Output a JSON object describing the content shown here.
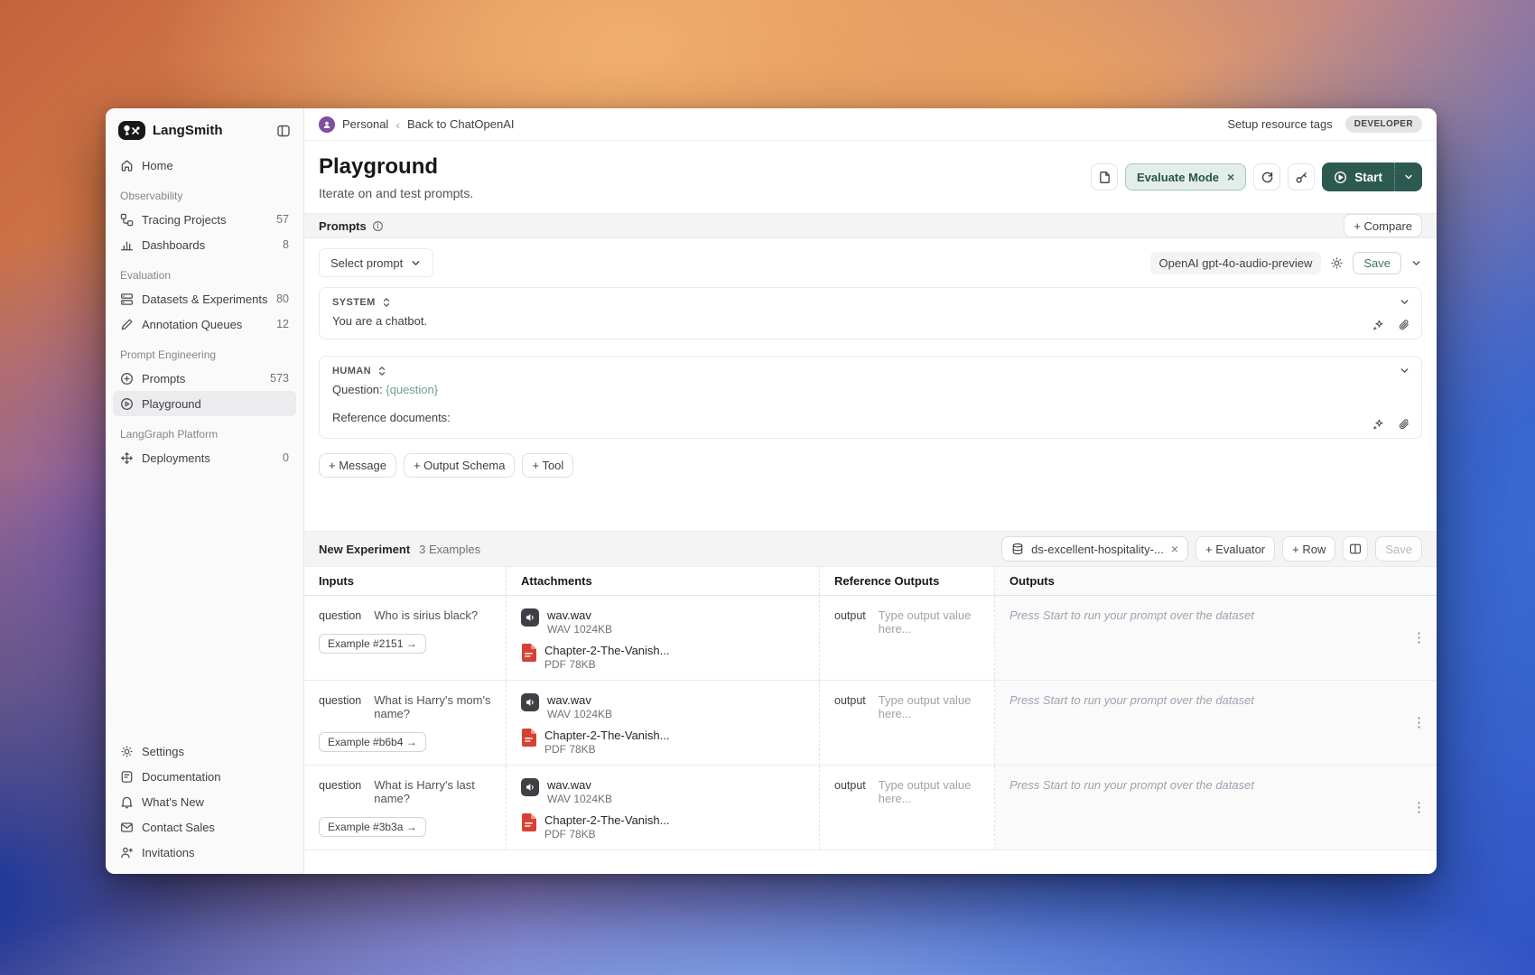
{
  "icons": {
    "crumb_sep": "‹",
    "close": "×",
    "overflow": "⋮"
  },
  "sidebar": {
    "brand": "LangSmith",
    "home": {
      "label": "Home"
    },
    "sections": [
      {
        "label": "Observability",
        "items": [
          {
            "label": "Tracing Projects",
            "count": "57"
          },
          {
            "label": "Dashboards",
            "count": "8"
          }
        ]
      },
      {
        "label": "Evaluation",
        "items": [
          {
            "label": "Datasets & Experiments",
            "count": "80"
          },
          {
            "label": "Annotation Queues",
            "count": "12"
          }
        ]
      },
      {
        "label": "Prompt Engineering",
        "items": [
          {
            "label": "Prompts",
            "count": "573"
          },
          {
            "label": "Playground",
            "count": ""
          }
        ]
      },
      {
        "label": "LangGraph Platform",
        "items": [
          {
            "label": "Deployments",
            "count": "0"
          }
        ]
      }
    ],
    "footer": [
      {
        "label": "Settings"
      },
      {
        "label": "Documentation"
      },
      {
        "label": "What's New"
      },
      {
        "label": "Contact Sales"
      },
      {
        "label": "Invitations"
      }
    ]
  },
  "topbar": {
    "workspace": "Personal",
    "back": "Back to ChatOpenAI",
    "setup": "Setup resource tags",
    "badge": "DEVELOPER"
  },
  "header": {
    "title": "Playground",
    "subtitle": "Iterate on and test prompts.",
    "evaluate_mode": "Evaluate Mode",
    "start": "Start"
  },
  "prompts": {
    "title": "Prompts",
    "compare": "+ Compare",
    "select_prompt": "Select prompt",
    "model": "OpenAI gpt-4o-audio-preview",
    "save": "Save",
    "system_role": "SYSTEM",
    "system_text": "You are a chatbot.",
    "human_role": "HUMAN",
    "human_q_prefix": "Question: ",
    "human_q_var": "{question}",
    "human_ref": "Reference documents:",
    "add_message": "+ Message",
    "add_output_schema": "+ Output Schema",
    "add_tool": "+ Tool"
  },
  "experiment": {
    "title": "New Experiment",
    "examples": "3 Examples",
    "dataset": "ds-excellent-hospitality-...",
    "add_evaluator": "+ Evaluator",
    "add_row": "+ Row",
    "save": "Save"
  },
  "table": {
    "headers": [
      "Inputs",
      "Attachments",
      "Reference Outputs",
      "Outputs"
    ],
    "output_placeholder": "Press Start to run your prompt over the dataset",
    "rows": [
      {
        "key": "question",
        "value": "Who is sirius black?",
        "example": "Example #2151 →",
        "ref_key": "output",
        "ref_placeholder": "Type output value here...",
        "attachments": [
          {
            "name": "wav.wav",
            "meta": "WAV  1024KB"
          },
          {
            "name": "Chapter-2-The-Vanish...",
            "meta": "PDF  78KB"
          }
        ]
      },
      {
        "key": "question",
        "value": "What is Harry's mom's name?",
        "example": "Example #b6b4 →",
        "ref_key": "output",
        "ref_placeholder": "Type output value here...",
        "attachments": [
          {
            "name": "wav.wav",
            "meta": "WAV  1024KB"
          },
          {
            "name": "Chapter-2-The-Vanish...",
            "meta": "PDF  78KB"
          }
        ]
      },
      {
        "key": "question",
        "value": "What is Harry's last name?",
        "example": "Example #3b3a →",
        "ref_key": "output",
        "ref_placeholder": "Type output value here...",
        "attachments": [
          {
            "name": "wav.wav",
            "meta": "WAV  1024KB"
          },
          {
            "name": "Chapter-2-The-Vanish...",
            "meta": "PDF  78KB"
          }
        ]
      }
    ]
  },
  "colors": {
    "accent": "#2d5a50",
    "evaluate_bg": "#e3eeeb",
    "pdf_red": "#d64133",
    "audio_dark": "#3f3f46"
  }
}
